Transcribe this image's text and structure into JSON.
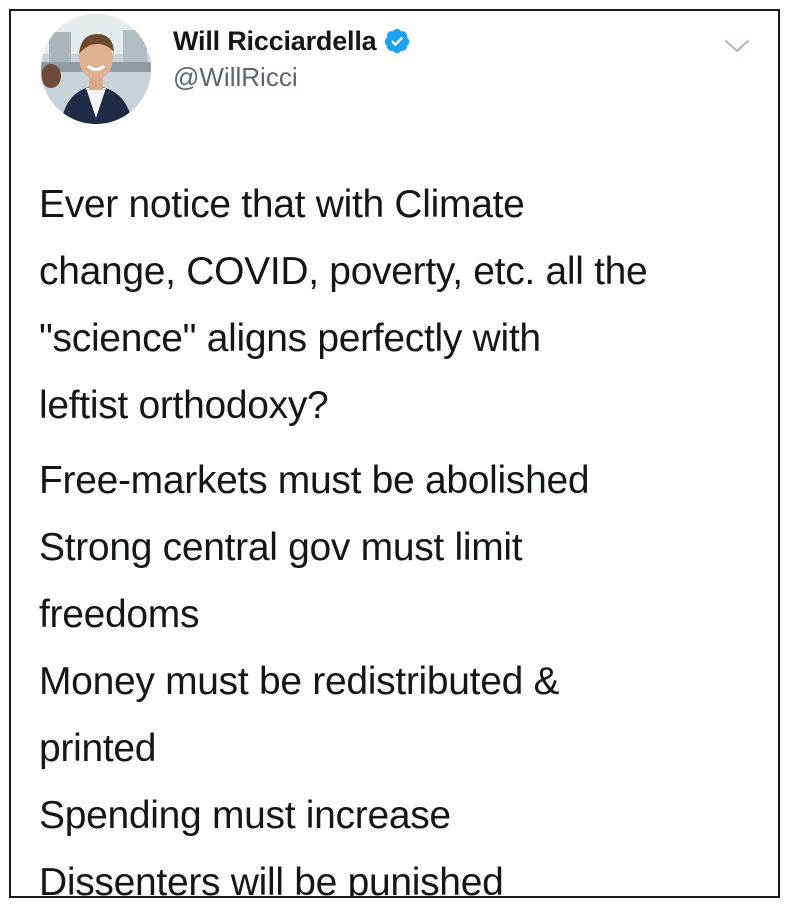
{
  "tweet": {
    "display_name": "Will Ricciardella",
    "handle": "@WillRicci",
    "verified": true,
    "verified_color": "#1da1f2",
    "body_lines_1": [
      "Ever notice that with Climate",
      "change, COVID, poverty, etc. all the",
      "\"science\" aligns perfectly with",
      "leftist orthodoxy?"
    ],
    "body_lines_2": [
      "Free-markets must be abolished",
      "Strong central gov must limit",
      "freedoms",
      "Money must be redistributed &",
      "printed",
      "Spending must increase",
      "Dissenters will be punished"
    ]
  },
  "icons": {
    "avatar": "avatar-photo",
    "verified": "verified-badge-icon",
    "menu": "chevron-down-icon"
  }
}
